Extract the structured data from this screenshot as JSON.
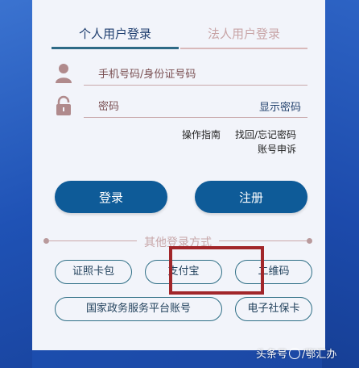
{
  "tabs": {
    "personal": "个人用户登录",
    "legal": "法人用户登录"
  },
  "form": {
    "phone_placeholder": "手机号码/身份证号码",
    "password_placeholder": "密码",
    "show_password": "显示密码"
  },
  "links": {
    "guide": "操作指南",
    "forgot": "找回/忘记密码",
    "appeal": "账号申诉"
  },
  "buttons": {
    "login": "登录",
    "register": "注册"
  },
  "divider_label": "其他登录方式",
  "alt_logins": {
    "wallet": "证照卡包",
    "alipay": "支付宝",
    "qrcode": "二维码",
    "gov_account": "国家政务服务平台账号",
    "social_card": "电子社保卡"
  },
  "watermark": {
    "prefix": "头条号",
    "name": "/鄂汇办"
  },
  "colors": {
    "primary": "#0e5b98",
    "accent_border": "#2f6f86",
    "highlight": "#a1262a"
  },
  "icons": {
    "user": "user-icon",
    "lock": "lock-icon"
  }
}
